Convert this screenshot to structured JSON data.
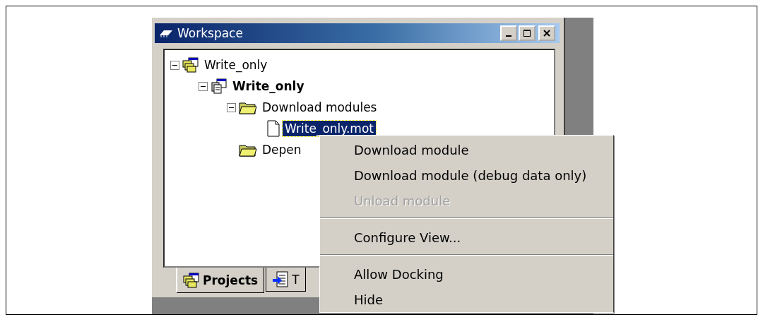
{
  "window": {
    "title": "Workspace"
  },
  "tree": [
    {
      "label": "Write_only",
      "kind": "workspace",
      "expanded": true,
      "active": false,
      "selected": false,
      "children": [
        {
          "label": "Write_only",
          "kind": "project",
          "expanded": true,
          "active": true,
          "selected": false,
          "children": [
            {
              "label": "Download modules",
              "kind": "folder",
              "expanded": true,
              "active": false,
              "selected": false,
              "children": [
                {
                  "label": "Write_only.mot",
                  "kind": "file",
                  "active": false,
                  "selected": true
                }
              ]
            },
            {
              "label": "Depen",
              "kind": "folder",
              "active": false,
              "selected": false
            }
          ]
        }
      ]
    }
  ],
  "tabs": [
    {
      "label": "Projects",
      "kind": "projects",
      "selected": true
    },
    {
      "label": "T",
      "kind": "templates",
      "selected": false
    }
  ],
  "context_menu": [
    {
      "kind": "item",
      "label": "Download module",
      "disabled": false
    },
    {
      "kind": "item",
      "label": "Download module (debug data only)",
      "disabled": false
    },
    {
      "kind": "item",
      "label": "Unload module",
      "disabled": true
    },
    {
      "kind": "separator"
    },
    {
      "kind": "item",
      "label": "Configure View...",
      "disabled": false
    },
    {
      "kind": "separator"
    },
    {
      "kind": "item",
      "label": "Allow Docking",
      "disabled": false
    },
    {
      "kind": "item",
      "label": "Hide",
      "disabled": false
    }
  ]
}
